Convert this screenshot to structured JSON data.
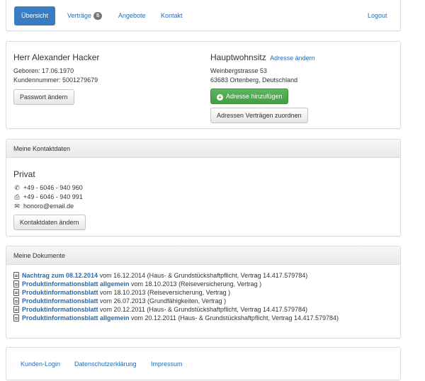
{
  "nav": {
    "overview": "Übersicht",
    "contracts": "Verträge",
    "contracts_count": "5",
    "offers": "Angebote",
    "contact": "Kontakt",
    "logout": "Logout"
  },
  "profile": {
    "name": "Herr Alexander Hacker",
    "born": "Geboren: 17.06.1970",
    "customer_no": "Kundennummer: 5001279679",
    "change_password": "Passwort ändern",
    "address_title": "Hauptwohnsitz",
    "change_address": "Adresse ändern",
    "street": "Weinbergstrasse 53",
    "city": "63683 Ortenberg, Deutschland",
    "add_address": "Adresse hinzufügen",
    "assign_addresses": "Adressen Verträgen zuordnen"
  },
  "contact": {
    "heading": "Meine Kontaktdaten",
    "type": "Privat",
    "phone": "+49 - 6046 - 940 960",
    "fax": "+49 - 6046 - 940 991",
    "email": "honoro@email.de",
    "change": "Kontaktdaten ändern",
    "icons": [
      "phone-icon",
      "fax-icon",
      "envelope-icon"
    ]
  },
  "documents": {
    "heading": "Meine Dokumente",
    "items": [
      {
        "link": "Nachtrag zum 08.12.2014",
        "text": " vom 16.12.2014 (Haus- & Grundstückshaftpflicht, Vertrag 14.417.579784)"
      },
      {
        "link": "Produktinformationsblatt allgemein",
        "text": " vom 18.10.2013 (Reiseversicherung, Vertrag )"
      },
      {
        "link": "Produktinformationsblatt",
        "text": " vom 18.10.2013 (Reiseversicherung, Vertrag )"
      },
      {
        "link": "Produktinformationsblatt",
        "text": " vom 26.07.2013 (Grundfähigkeiten, Vertrag )"
      },
      {
        "link": "Produktinformationsblatt",
        "text": " vom 20.12.2011 (Haus- & Grundstückshaftpflicht, Vertrag 14.417.579784)"
      },
      {
        "link": "Produktinformationsblatt allgemein",
        "text": " vom 20.12.2011 (Haus- & Grundstückshaftpflicht, Vertrag 14.417.579784)"
      }
    ]
  },
  "footer": {
    "login": "Kunden-Login",
    "privacy": "Datenschutzerklärung",
    "imprint": "Impressum"
  },
  "colors": {
    "link": "#2a6ab0",
    "nav_active": "#3a7cc2",
    "success": "#5cb85c"
  }
}
